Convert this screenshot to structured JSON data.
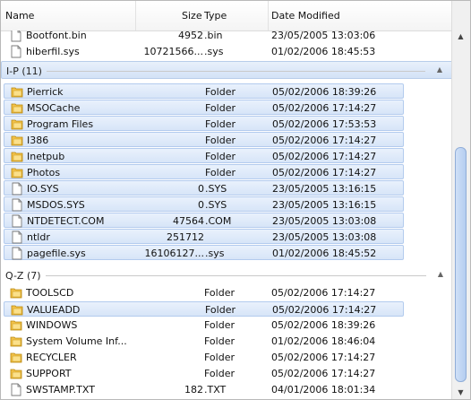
{
  "columns": {
    "name": "Name",
    "size": "Size",
    "type": "Type",
    "date": "Date Modified"
  },
  "colors": {
    "selection": "#d7e5f8",
    "folder": "#f3c24a",
    "accent": "#b3cbee"
  },
  "scrollbar": {
    "up_icon": "▲",
    "down_icon": "▼"
  },
  "top_rows": [
    {
      "icon": "file-icon",
      "name": "Bootfont.bin",
      "size": "4952",
      "type": ".bin",
      "date": "23/05/2005 13:03:06"
    },
    {
      "icon": "file-icon",
      "name": "hiberfil.sys",
      "size": "10721566...",
      "type": ".sys",
      "date": "01/02/2006 18:45:53"
    }
  ],
  "group_ip": {
    "label": "I-P (11)",
    "arrow": "▲",
    "rows": [
      {
        "icon": "folder-icon",
        "name": "Pierrick",
        "size": "",
        "type": "Folder",
        "date": "05/02/2006 18:39:26"
      },
      {
        "icon": "folder-icon",
        "name": "MSOCache",
        "size": "",
        "type": "Folder",
        "date": "05/02/2006 17:14:27"
      },
      {
        "icon": "folder-icon",
        "name": "Program Files",
        "size": "",
        "type": "Folder",
        "date": "05/02/2006 17:53:53"
      },
      {
        "icon": "folder-icon",
        "name": "I386",
        "size": "",
        "type": "Folder",
        "date": "05/02/2006 17:14:27"
      },
      {
        "icon": "folder-icon",
        "name": "Inetpub",
        "size": "",
        "type": "Folder",
        "date": "05/02/2006 17:14:27"
      },
      {
        "icon": "folder-icon",
        "name": "Photos",
        "size": "",
        "type": "Folder",
        "date": "05/02/2006 17:14:27"
      },
      {
        "icon": "file-icon",
        "name": "IO.SYS",
        "size": "0",
        "type": ".SYS",
        "date": "23/05/2005 13:16:15"
      },
      {
        "icon": "file-icon",
        "name": "MSDOS.SYS",
        "size": "0",
        "type": ".SYS",
        "date": "23/05/2005 13:16:15"
      },
      {
        "icon": "file-icon",
        "name": "NTDETECT.COM",
        "size": "47564",
        "type": ".COM",
        "date": "23/05/2005 13:03:08"
      },
      {
        "icon": "file-icon",
        "name": "ntldr",
        "size": "251712",
        "type": "",
        "date": "23/05/2005 13:03:08"
      },
      {
        "icon": "file-icon",
        "name": "pagefile.sys",
        "size": "16106127...",
        "type": ".sys",
        "date": "01/02/2006 18:45:52"
      }
    ]
  },
  "group_qz": {
    "label": "Q-Z (7)",
    "arrow": "▲",
    "rows": [
      {
        "icon": "folder-icon",
        "name": "TOOLSCD",
        "size": "",
        "type": "Folder",
        "date": "05/02/2006 17:14:27",
        "selected": false
      },
      {
        "icon": "folder-icon",
        "name": "VALUEADD",
        "size": "",
        "type": "Folder",
        "date": "05/02/2006 17:14:27",
        "selected": true
      },
      {
        "icon": "folder-icon",
        "name": "WINDOWS",
        "size": "",
        "type": "Folder",
        "date": "05/02/2006 18:39:26",
        "selected": false
      },
      {
        "icon": "folder-icon",
        "name": "System Volume Inf...",
        "size": "",
        "type": "Folder",
        "date": "01/02/2006 18:46:04",
        "selected": false
      },
      {
        "icon": "folder-icon",
        "name": "RECYCLER",
        "size": "",
        "type": "Folder",
        "date": "05/02/2006 17:14:27",
        "selected": false
      },
      {
        "icon": "folder-icon",
        "name": "SUPPORT",
        "size": "",
        "type": "Folder",
        "date": "05/02/2006 17:14:27",
        "selected": false
      },
      {
        "icon": "file-icon",
        "name": "SWSTAMP.TXT",
        "size": "182",
        "type": ".TXT",
        "date": "04/01/2006 18:01:34",
        "selected": false
      }
    ]
  }
}
